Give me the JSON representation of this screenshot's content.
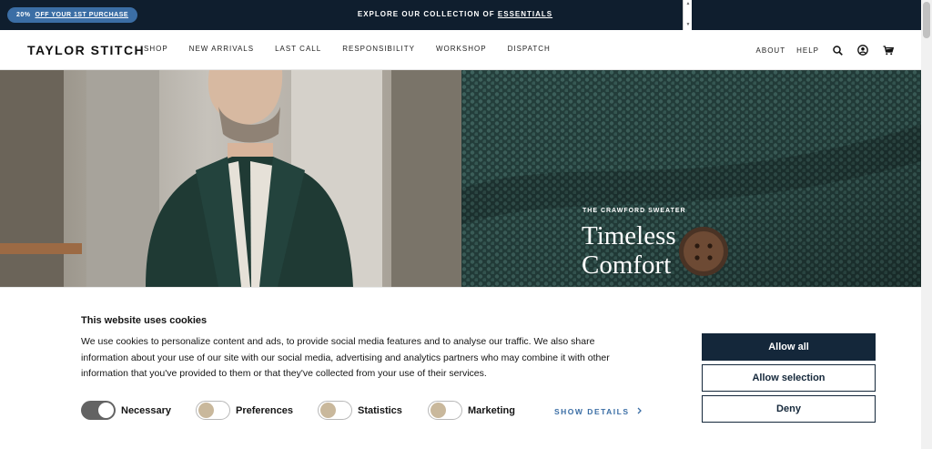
{
  "announcement": {
    "promo_percent": "20%",
    "promo_link": "OFF YOUR 1ST PURCHASE",
    "message_prefix": "EXPLORE OUR COLLECTION OF",
    "message_link": "ESSENTIALS",
    "colors": {
      "bar": "#0f1e2e",
      "pill": "#3b6ea5"
    }
  },
  "header": {
    "logo": "TAYLOR STITCH",
    "nav": [
      "SHOP",
      "NEW ARRIVALS",
      "LAST CALL",
      "RESPONSIBILITY",
      "WORKSHOP",
      "DISPATCH"
    ],
    "about": "ABOUT",
    "help": "HELP",
    "icons": [
      "search-icon",
      "account-icon",
      "cart-icon"
    ]
  },
  "hero": {
    "eyebrow": "THE CRAWFORD SWEATER",
    "title": "Timeless Comfort",
    "colors": {
      "knit": "#2f4b48"
    }
  },
  "cookie": {
    "title": "This website uses cookies",
    "body": "We use cookies to personalize content and ads, to provide social media features and to analyse our traffic. We also share information about your use of our site with our social media, advertising and analytics partners who may combine it with other information that you've provided to them or that they've collected from your use of their services.",
    "toggles": [
      {
        "label": "Necessary",
        "on": true
      },
      {
        "label": "Preferences",
        "on": false
      },
      {
        "label": "Statistics",
        "on": false
      },
      {
        "label": "Marketing",
        "on": false
      }
    ],
    "details_link": "SHOW DETAILS",
    "buttons": {
      "allow_all": "Allow all",
      "allow_selection": "Allow selection",
      "deny": "Deny"
    },
    "colors": {
      "primary": "#14273a",
      "link": "#3b6ea5"
    }
  }
}
